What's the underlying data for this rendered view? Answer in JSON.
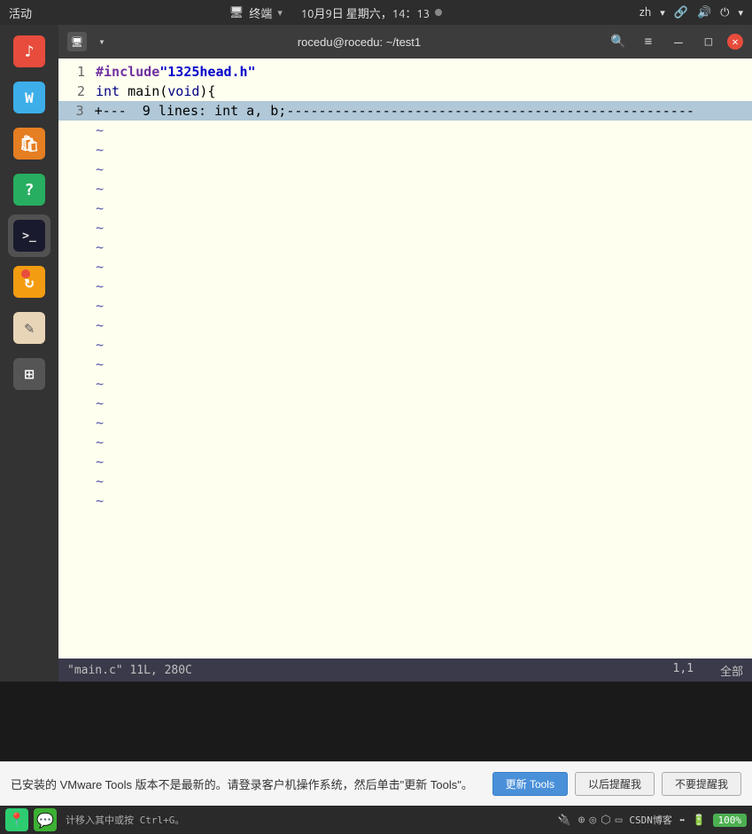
{
  "topbar": {
    "activities": "活动",
    "terminal_label": "终端",
    "datetime": "10月9日 星期六，14：13",
    "lang": "zh",
    "dropdown_arrow": "▾"
  },
  "titlebar": {
    "title": "rocedu@rocedu: ~/test1",
    "search_icon": "🔍",
    "menu_icon": "≡",
    "min_icon": "—",
    "max_icon": "□",
    "close_icon": "✕"
  },
  "editor": {
    "lines": [
      {
        "num": "1",
        "type": "code",
        "content": "#include\"1325head.h\""
      },
      {
        "num": "2",
        "type": "code",
        "content": "int main(void){"
      },
      {
        "num": "3",
        "type": "highlighted",
        "content": "+---  9 lines: int a, b;-----------------------------------"
      }
    ],
    "tilde_lines": 20
  },
  "statusbar": {
    "file_info": "\"main.c\" 11L, 280C",
    "position": "1,1",
    "scroll": "全部"
  },
  "notification": {
    "text": "已安装的 VMware Tools 版本不是最新的。请登录客户机操作系统，然后单击\"更新 Tools\"。",
    "btn_update": "更新 Tools",
    "btn_later": "以后提醒我",
    "btn_never": "不要提醒我"
  },
  "bottombar": {
    "hint": "计移入其中或按 Ctrl+G。",
    "battery": "100%"
  },
  "sidebar": {
    "items": [
      {
        "name": "music",
        "label": "♪"
      },
      {
        "name": "writer",
        "label": "W"
      },
      {
        "name": "appstore",
        "label": "🛍"
      },
      {
        "name": "help",
        "label": "?"
      },
      {
        "name": "terminal",
        "label": ">_"
      },
      {
        "name": "update",
        "label": "↻"
      },
      {
        "name": "edit",
        "label": "✎"
      },
      {
        "name": "grid",
        "label": "⊞"
      }
    ]
  }
}
